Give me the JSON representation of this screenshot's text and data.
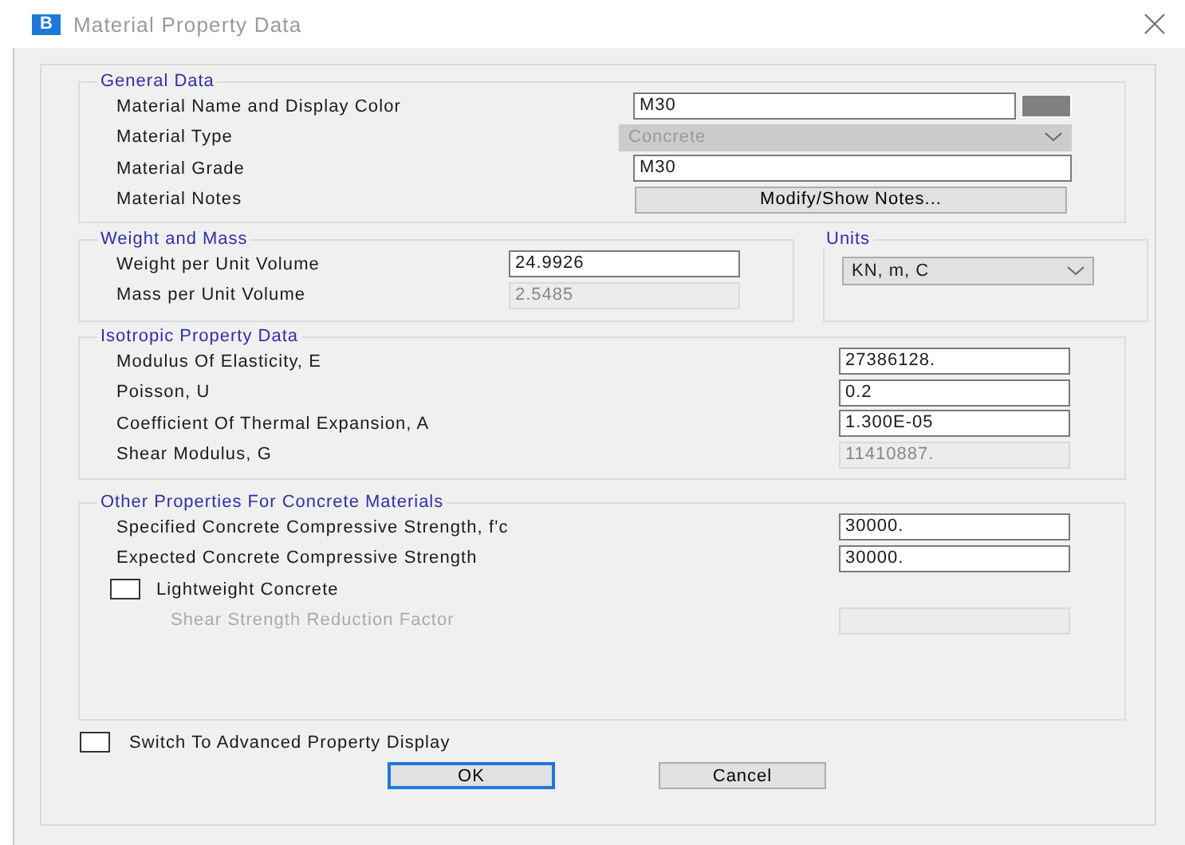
{
  "window": {
    "badge": "B",
    "title": "Material Property Data"
  },
  "general_data": {
    "title": "General Data",
    "rows": [
      {
        "kind": "text",
        "label": "Material Name and Display Color",
        "value": "M30",
        "disabled": false,
        "color": "#808080"
      },
      {
        "kind": "dropdown",
        "label": "Material Type",
        "value": "Concrete",
        "disabled": true
      },
      {
        "kind": "text",
        "label": "Material Grade",
        "value": "M30",
        "disabled": false
      },
      {
        "kind": "button",
        "label": "Material Notes",
        "button": "Modify/Show Notes..."
      }
    ]
  },
  "weight_and_mass": {
    "title": "Weight and Mass",
    "rows": [
      {
        "kind": "text",
        "label": "Weight per Unit Volume",
        "value": "24.9926",
        "disabled": false
      },
      {
        "kind": "text",
        "label": "Mass per Unit Volume",
        "value": "2.5485",
        "disabled": true
      }
    ]
  },
  "units": {
    "title": "Units",
    "value": "KN, m, C"
  },
  "isotropic": {
    "title": "Isotropic Property Data",
    "rows": [
      {
        "kind": "text",
        "label": "Modulus Of Elasticity,  E",
        "value": "27386128.",
        "disabled": false
      },
      {
        "kind": "text",
        "label": "Poisson, U",
        "value": "0.2",
        "disabled": false
      },
      {
        "kind": "text",
        "label": "Coefficient Of Thermal Expansion,  A",
        "value": "1.300E-05",
        "disabled": false
      },
      {
        "kind": "text",
        "label": "Shear Modulus,  G",
        "value": "11410887.",
        "disabled": true
      }
    ]
  },
  "concrete": {
    "title": "Other Properties For Concrete Materials",
    "rows": [
      {
        "kind": "text",
        "label": "Specified Concrete Compressive Strength, f'c",
        "value": "30000.",
        "disabled": false
      },
      {
        "kind": "text",
        "label": "Expected Concrete Compressive Strength",
        "value": "30000.",
        "disabled": false
      },
      {
        "kind": "checkbox",
        "label": "Lightweight Concrete",
        "checked": false
      },
      {
        "kind": "subfield",
        "label": "Shear Strength Reduction Factor",
        "disabled": true
      }
    ]
  },
  "advanced": {
    "label": "Switch To Advanced Property Display",
    "checked": false
  },
  "buttons": [
    {
      "label": "OK",
      "default": true
    },
    {
      "label": "Cancel",
      "default": false
    }
  ]
}
